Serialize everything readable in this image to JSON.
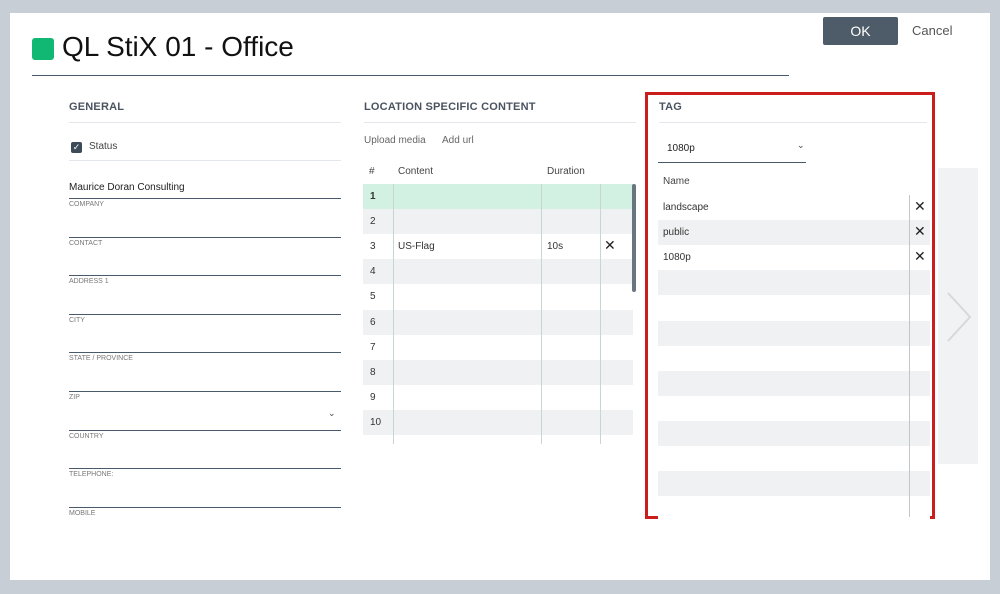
{
  "header": {
    "title": "QL StiX 01 - Office",
    "status_color": "#10b874",
    "ok_label": "OK",
    "cancel_label": "Cancel"
  },
  "general": {
    "heading": "GENERAL",
    "status_label": "Status",
    "status_checked": true,
    "fields": [
      {
        "label": "COMPANY",
        "value": "Maurice Doran Consulting"
      },
      {
        "label": "CONTACT",
        "value": ""
      },
      {
        "label": "ADDRESS 1",
        "value": ""
      },
      {
        "label": "CITY",
        "value": ""
      },
      {
        "label": "STATE / PROVINCE",
        "value": ""
      },
      {
        "label": "ZIP",
        "value": ""
      },
      {
        "label": "COUNTRY",
        "value": ""
      },
      {
        "label": "TELEPHONE:",
        "value": ""
      },
      {
        "label": "MOBILE",
        "value": ""
      }
    ]
  },
  "location": {
    "heading": "LOCATION SPECIFIC CONTENT",
    "upload_label": "Upload media",
    "add_url_label": "Add url",
    "columns": {
      "num": "#",
      "content": "Content",
      "duration": "Duration"
    },
    "rows": [
      {
        "num": "1",
        "content": "",
        "duration": ""
      },
      {
        "num": "2",
        "content": "",
        "duration": ""
      },
      {
        "num": "3",
        "content": "US-Flag",
        "duration": "10s"
      },
      {
        "num": "4",
        "content": "",
        "duration": ""
      },
      {
        "num": "5",
        "content": "",
        "duration": ""
      },
      {
        "num": "6",
        "content": "",
        "duration": ""
      },
      {
        "num": "7",
        "content": "",
        "duration": ""
      },
      {
        "num": "8",
        "content": "",
        "duration": ""
      },
      {
        "num": "9",
        "content": "",
        "duration": ""
      },
      {
        "num": "10",
        "content": "",
        "duration": ""
      }
    ]
  },
  "tag": {
    "heading": "TAG",
    "selected": "1080p",
    "column_name": "Name",
    "items": [
      "landscape",
      "public",
      "1080p"
    ]
  },
  "icons": {
    "check": "check-icon",
    "close": "close-icon",
    "chevron": "chevron-down-icon",
    "next": "chevron-right-icon"
  }
}
